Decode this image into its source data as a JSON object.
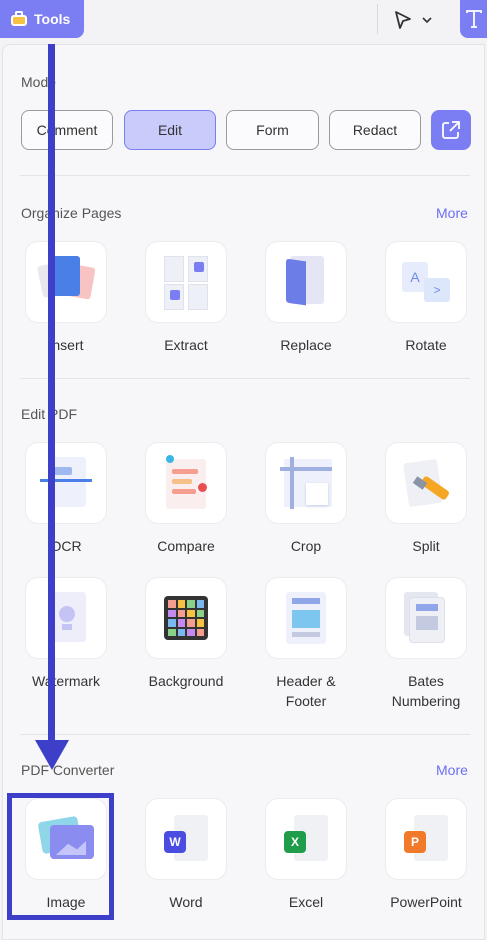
{
  "topbar": {
    "tools_label": "Tools"
  },
  "mode": {
    "title": "Mode",
    "buttons": [
      {
        "label": "Comment"
      },
      {
        "label": "Edit"
      },
      {
        "label": "Form"
      },
      {
        "label": "Redact"
      }
    ],
    "active": "Edit"
  },
  "organize_pages": {
    "title": "Organize Pages",
    "more": "More",
    "tools": [
      {
        "label": "Insert",
        "icon": "insert-icon"
      },
      {
        "label": "Extract",
        "icon": "extract-icon"
      },
      {
        "label": "Replace",
        "icon": "replace-icon"
      },
      {
        "label": "Rotate",
        "icon": "rotate-icon"
      }
    ]
  },
  "edit_pdf": {
    "title": "Edit PDF",
    "tools": [
      {
        "label": "OCR",
        "icon": "ocr-icon"
      },
      {
        "label": "Compare",
        "icon": "compare-icon"
      },
      {
        "label": "Crop",
        "icon": "crop-icon"
      },
      {
        "label": "Split",
        "icon": "split-icon"
      },
      {
        "label": "Watermark",
        "icon": "watermark-icon"
      },
      {
        "label": "Background",
        "icon": "background-icon"
      },
      {
        "label": "Header &\nFooter",
        "icon": "header-footer-icon"
      },
      {
        "label": "Bates\nNumbering",
        "icon": "bates-numbering-icon"
      }
    ]
  },
  "pdf_converter": {
    "title": "PDF Converter",
    "more": "More",
    "tools": [
      {
        "label": "Image",
        "icon": "image-icon"
      },
      {
        "label": "Word",
        "icon": "word-icon"
      },
      {
        "label": "Excel",
        "icon": "excel-icon"
      },
      {
        "label": "PowerPoint",
        "icon": "powerpoint-icon"
      }
    ]
  },
  "colors": {
    "accent": "#7b7df2",
    "annotation": "#3d3fc9",
    "more_link": "#6c6ff0"
  }
}
